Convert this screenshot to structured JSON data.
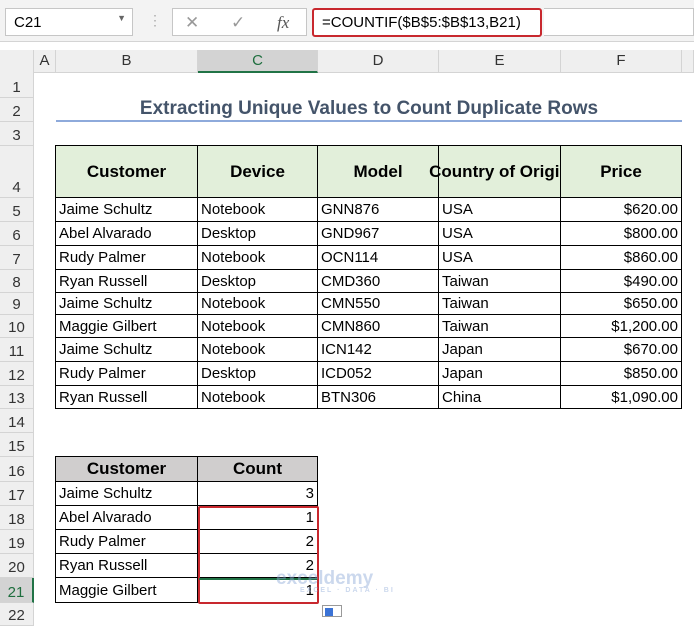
{
  "namebox": "C21",
  "formula": "=COUNTIF($B$5:$B$13,B21)",
  "columns": [
    "A",
    "B",
    "C",
    "D",
    "E",
    "F"
  ],
  "rows": [
    "1",
    "2",
    "3",
    "4",
    "5",
    "6",
    "7",
    "8",
    "9",
    "10",
    "11",
    "12",
    "13",
    "14",
    "15",
    "16",
    "17",
    "18",
    "19",
    "20",
    "21",
    "22"
  ],
  "title": "Extracting Unique Values to Count Duplicate Rows",
  "table": {
    "headers": [
      "Customer",
      "Device",
      "Model",
      "Country of Origin",
      "Price"
    ],
    "rows": [
      [
        "Jaime Schultz",
        "Notebook",
        "GNN876",
        "USA",
        "$620.00"
      ],
      [
        "Abel Alvarado",
        "Desktop",
        "GND967",
        "USA",
        "$800.00"
      ],
      [
        "Rudy Palmer",
        "Notebook",
        "OCN114",
        "USA",
        "$860.00"
      ],
      [
        "Ryan Russell",
        "Desktop",
        "CMD360",
        "Taiwan",
        "$490.00"
      ],
      [
        "Jaime Schultz",
        "Notebook",
        "CMN550",
        "Taiwan",
        "$650.00"
      ],
      [
        "Maggie Gilbert",
        "Notebook",
        "CMN860",
        "Taiwan",
        "$1,200.00"
      ],
      [
        "Jaime Schultz",
        "Notebook",
        "ICN142",
        "Japan",
        "$670.00"
      ],
      [
        "Rudy Palmer",
        "Desktop",
        "ICD052",
        "Japan",
        "$850.00"
      ],
      [
        "Ryan Russell",
        "Notebook",
        "BTN306",
        "China",
        "$1,090.00"
      ]
    ]
  },
  "count_table": {
    "headers": [
      "Customer",
      "Count"
    ],
    "rows": [
      [
        "Jaime Schultz",
        "3"
      ],
      [
        "Abel Alvarado",
        "1"
      ],
      [
        "Rudy Palmer",
        "2"
      ],
      [
        "Ryan Russell",
        "2"
      ],
      [
        "Maggie Gilbert",
        "1"
      ]
    ]
  },
  "watermark": {
    "name": "exceldemy",
    "tagline": "EXCEL · DATA · BI"
  },
  "colors": {
    "accent_red": "#c8282e",
    "header_green": "#e2efda",
    "header_gray": "#d0cece",
    "excel_green": "#217346"
  }
}
